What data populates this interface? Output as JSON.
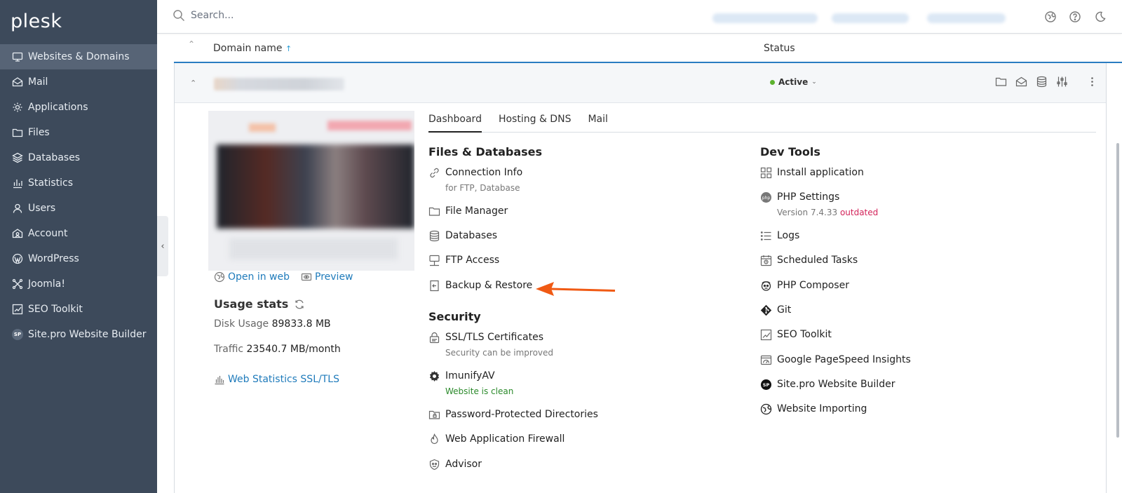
{
  "brand": {
    "logo_text": "plesk"
  },
  "search": {
    "placeholder": "Search..."
  },
  "sidebar": {
    "items": [
      {
        "label": "Websites & Domains",
        "icon": "monitor-icon",
        "active": true
      },
      {
        "label": "Mail",
        "icon": "mail-icon"
      },
      {
        "label": "Applications",
        "icon": "gear-icon"
      },
      {
        "label": "Files",
        "icon": "folder-icon"
      },
      {
        "label": "Databases",
        "icon": "database-icon"
      },
      {
        "label": "Statistics",
        "icon": "bar-chart-icon"
      },
      {
        "label": "Users",
        "icon": "user-icon"
      },
      {
        "label": "Account",
        "icon": "account-icon"
      },
      {
        "label": "WordPress",
        "icon": "wordpress-icon"
      },
      {
        "label": "Joomla!",
        "icon": "joomla-icon"
      },
      {
        "label": "SEO Toolkit",
        "icon": "seo-icon"
      },
      {
        "label": "Site.pro Website Builder",
        "icon": "sitepro-icon",
        "badge": "SP"
      }
    ]
  },
  "table": {
    "col_domain": "Domain name",
    "col_domain_sort": "↑",
    "col_status": "Status"
  },
  "domain": {
    "status": "Active",
    "status_color": "#5cb22e"
  },
  "preview": {
    "open_in_web": "Open in web",
    "preview": "Preview"
  },
  "usage": {
    "title": "Usage stats",
    "disk_label": "Disk Usage",
    "disk_value": "89833.8 MB",
    "traffic_label": "Traffic",
    "traffic_value": "23540.7 MB/month",
    "webstats": "Web Statistics SSL/TLS"
  },
  "tabs": [
    "Dashboard",
    "Hosting & DNS",
    "Mail"
  ],
  "files_db": {
    "title": "Files & Databases",
    "items": [
      {
        "label": "Connection Info",
        "sub": "for FTP, Database"
      },
      {
        "label": "File Manager"
      },
      {
        "label": "Databases"
      },
      {
        "label": "FTP Access"
      },
      {
        "label": "Backup & Restore"
      }
    ]
  },
  "security": {
    "title": "Security",
    "items": [
      {
        "label": "SSL/TLS Certificates",
        "sub": "Security can be improved"
      },
      {
        "label": "ImunifyAV",
        "sub": "Website is clean"
      },
      {
        "label": "Password-Protected Directories"
      },
      {
        "label": "Web Application Firewall"
      },
      {
        "label": "Advisor"
      }
    ]
  },
  "dev_tools": {
    "title": "Dev Tools",
    "items": [
      {
        "label": "Install application"
      },
      {
        "label": "PHP Settings",
        "sub_prefix": "Version 7.4.33",
        "sub_warn": "outdated"
      },
      {
        "label": "Logs"
      },
      {
        "label": "Scheduled Tasks"
      },
      {
        "label": "PHP Composer"
      },
      {
        "label": "Git"
      },
      {
        "label": "SEO Toolkit"
      },
      {
        "label": "Google PageSpeed Insights"
      },
      {
        "label": "Site.pro Website Builder"
      },
      {
        "label": "Website Importing"
      }
    ]
  },
  "colors": {
    "sidebar_bg": "#3d4a5b",
    "link": "#1f7bbb",
    "accent_line": "#2a7cc1",
    "arrow": "#f05a14",
    "warning": "#d3245a",
    "success": "#2b8a2b"
  }
}
